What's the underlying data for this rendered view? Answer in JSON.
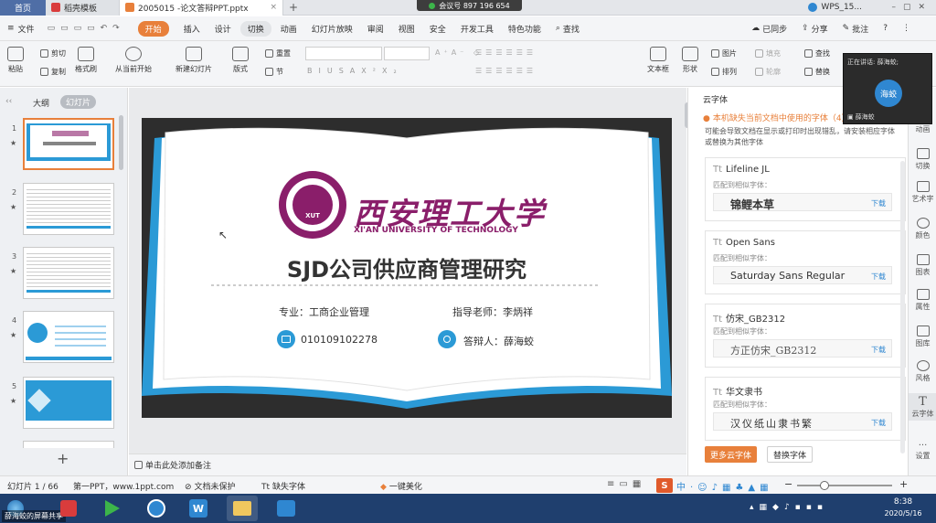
{
  "tabs": {
    "home": "首页",
    "tab1": "稻壳模板",
    "tab2": "2005015 -论文答辩PPT.pptx",
    "add": "+",
    "wps": "WPS_15..."
  },
  "meeting": "会议号 897 196 654",
  "menubar": {
    "file": "文件",
    "items": [
      "开始",
      "插入",
      "设计",
      "切换",
      "动画",
      "幻灯片放映",
      "审阅",
      "视图",
      "安全",
      "开发工具",
      "特色功能"
    ],
    "search": "查找",
    "sync": "已同步",
    "share": "分享",
    "annotate": "批注",
    "help": "?"
  },
  "ribbon": {
    "paste": "粘贴",
    "cut": "剪切",
    "copy": "复制",
    "format_painter": "格式刷",
    "from_current": "从当前开始",
    "new_slide": "新建幻灯片",
    "layout": "版式",
    "section": "节",
    "reset": "重置",
    "textbox": "文本框",
    "shape": "形状",
    "arrange": "排列",
    "picture": "图片",
    "fill": "填充",
    "outline": "轮廓",
    "find": "查找",
    "replace": "替换",
    "font_btns": [
      "B",
      "I",
      "U",
      "S",
      "A",
      "X²",
      "X₂"
    ]
  },
  "leftpanel": {
    "outline_tab": "大纲",
    "slides_tab": "幻灯片",
    "thumbs": [
      {
        "num": "1",
        "star": "★"
      },
      {
        "num": "2",
        "star": "★"
      },
      {
        "num": "3",
        "star": "★"
      },
      {
        "num": "4",
        "star": "★"
      },
      {
        "num": "5",
        "star": "★"
      }
    ],
    "add": "+"
  },
  "slide": {
    "uni_cn": "西安理工大学",
    "uni_en": "XI'AN UNIVERSITY OF TECHNOLOGY",
    "seal_text": "XUT",
    "title": "SJD公司供应商管理研究",
    "major": "专业：工商企业管理",
    "advisor": "指导老师：李炳祥",
    "student_id": "010109102278",
    "defender": "答辩人：薛海蛟"
  },
  "notes_placeholder": "单击此处添加备注",
  "rightpanel": {
    "title": "云字体",
    "warning": "本机缺失当前文档中使用的字体（4）",
    "hint": "可能会导致文档在显示或打印时出现错乱，请安装相应字体或替换为其他字体",
    "fonts": [
      {
        "name": "Lifeline JL",
        "match_label": "匹配到相似字体：",
        "match": "锦鲤本草",
        "download": "下载"
      },
      {
        "name": "Open Sans",
        "match_label": "匹配到相似字体：",
        "match": "Saturday Sans Regular",
        "download": "下载"
      },
      {
        "name": "仿宋_GB2312",
        "match_label": "匹配到相似字体：",
        "match": "方正仿宋_GB2312",
        "download": "下载"
      },
      {
        "name": "华文隶书",
        "match_label": "匹配到相似字体：",
        "match": "汉仪纸山隶书繁",
        "download": "下载"
      }
    ],
    "more_btn": "更多云字体",
    "replace_btn": "替换字体"
  },
  "sidebar": [
    "动画",
    "切换",
    "艺术字",
    "颜色",
    "图表",
    "属性",
    "图库",
    "风格",
    "云字体",
    "设置"
  ],
  "statusbar": {
    "slide_count": "幻灯片 1 / 66",
    "theme": "第一PPT，www.1ppt.com",
    "protect": "文档未保护",
    "missing_font": "缺失字体",
    "beautify": "一键美化",
    "zoom_minus": "−",
    "zoom_plus": "+"
  },
  "video": {
    "speaking": "正在讲话: 薛海蛟;",
    "avatar": "海蛟",
    "name": "薛海蛟"
  },
  "taskbar": {
    "screen_share": "薛海蛟的屏幕共享",
    "time": "8:38",
    "date": "2020/5/16"
  },
  "colors": {
    "accent": "#e8803b",
    "taskbar": "#1f3f6e",
    "slide_blue": "#2b9ad6",
    "uni_purple": "#8a1e6a"
  }
}
